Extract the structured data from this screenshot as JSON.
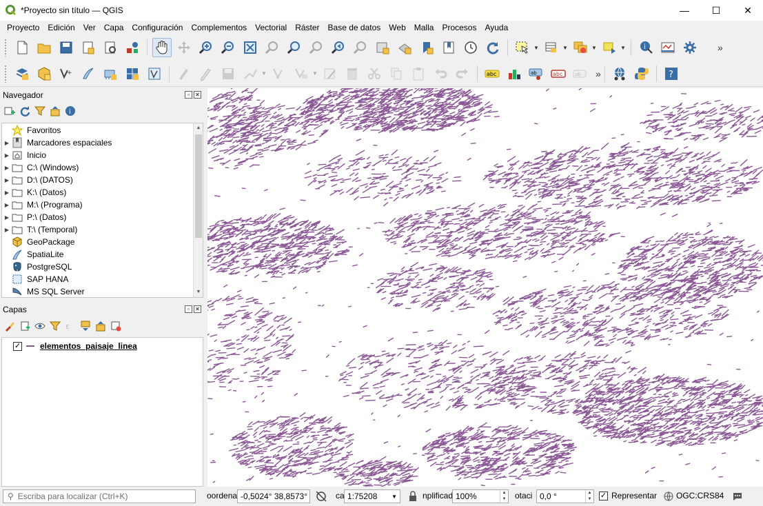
{
  "window": {
    "title": "*Proyecto sin título — QGIS",
    "minimize": "—",
    "maximize": "☐",
    "close": "✕"
  },
  "menu": [
    "Proyecto",
    "Edición",
    "Ver",
    "Capa",
    "Configuración",
    "Complementos",
    "Vectorial",
    "Ráster",
    "Base de datos",
    "Web",
    "Malla",
    "Procesos",
    "Ayuda"
  ],
  "toolbar_more": "»",
  "navigator": {
    "title": "Navegador",
    "items": [
      {
        "label": "Favoritos",
        "icon": "star-icon",
        "expandable": false
      },
      {
        "label": "Marcadores espaciales",
        "icon": "bookmarks-icon",
        "expandable": true
      },
      {
        "label": "Inicio",
        "icon": "home-folder-icon",
        "expandable": true
      },
      {
        "label": "C:\\ (Windows)",
        "icon": "folder-icon",
        "expandable": true
      },
      {
        "label": "D:\\ (DATOS)",
        "icon": "folder-icon",
        "expandable": true
      },
      {
        "label": "K:\\ (Datos)",
        "icon": "folder-icon",
        "expandable": true
      },
      {
        "label": "M:\\ (Programa)",
        "icon": "folder-icon",
        "expandable": true
      },
      {
        "label": "P:\\ (Datos)",
        "icon": "folder-icon",
        "expandable": true
      },
      {
        "label": "T:\\ (Temporal)",
        "icon": "folder-icon",
        "expandable": true
      },
      {
        "label": "GeoPackage",
        "icon": "geopackage-icon",
        "expandable": false
      },
      {
        "label": "SpatiaLite",
        "icon": "spatialite-icon",
        "expandable": false
      },
      {
        "label": "PostgreSQL",
        "icon": "postgresql-icon",
        "expandable": false
      },
      {
        "label": "SAP HANA",
        "icon": "saphana-icon",
        "expandable": false
      },
      {
        "label": "MS SQL Server",
        "icon": "mssql-icon",
        "expandable": false
      }
    ]
  },
  "layers_panel": {
    "title": "Capas",
    "layers": [
      {
        "name": "elementos_paisaje_linea",
        "visible": true,
        "color": "#8b5896"
      }
    ]
  },
  "status": {
    "locator_placeholder": "Escriba para localizar (Ctrl+K)",
    "coord_label": "oordenac",
    "coord_value": "-0,5024°  38,8573°",
    "scale_label": "ca",
    "scale_value": "1:75208",
    "magnifier_label": "nplificad",
    "magnifier_value": "100%",
    "rotation_label": "otaci",
    "rotation_value": "0,0 °",
    "render_label": "Representar",
    "crs": "OGC:CRS84"
  },
  "colors": {
    "feature": "#8b5896",
    "map_bg": "#ffffff",
    "chrome": "#f0f0f0"
  }
}
